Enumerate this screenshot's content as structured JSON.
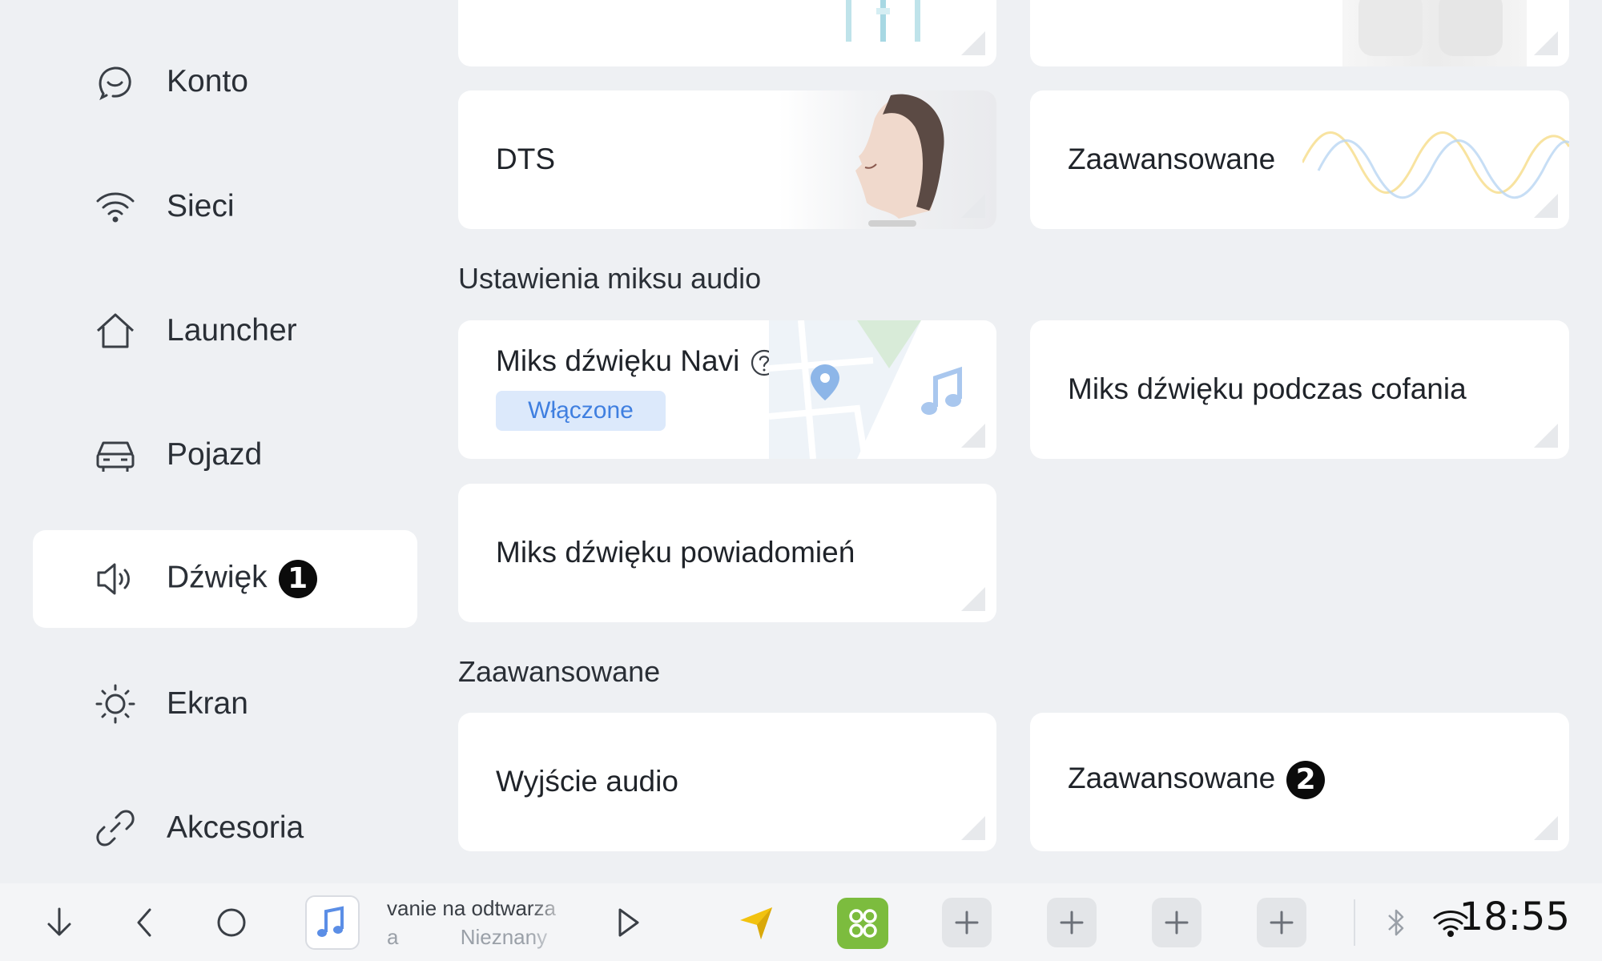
{
  "sidebar": {
    "items": [
      {
        "label": "Konto",
        "icon": "account-icon"
      },
      {
        "label": "Sieci",
        "icon": "wifi-icon"
      },
      {
        "label": "Launcher",
        "icon": "home-icon"
      },
      {
        "label": "Pojazd",
        "icon": "car-icon"
      },
      {
        "label": "Dźwięk",
        "icon": "speaker-icon",
        "active": true,
        "badge": "1"
      },
      {
        "label": "Ekran",
        "icon": "brightness-icon"
      },
      {
        "label": "Akcesoria",
        "icon": "link-icon"
      }
    ]
  },
  "content": {
    "top_cards": {
      "dts": "DTS",
      "advanced": "Zaawansowane"
    },
    "mix_section": {
      "title": "Ustawienia miksu audio",
      "navi_mix": {
        "label": "Miks dźwięku Navi",
        "status": "Włączone"
      },
      "reverse_mix": "Miks dźwięku podczas cofania",
      "notification_mix": "Miks dźwięku powiadomień"
    },
    "advanced_section": {
      "title": "Zaawansowane",
      "audio_output": "Wyjście audio",
      "advanced": "Zaawansowane",
      "badge": "2"
    }
  },
  "taskbar": {
    "media": {
      "title": "vanie na odtwarza",
      "subtitle_left": "a",
      "subtitle": "Nieznany"
    },
    "clock": "18:55"
  },
  "colors": {
    "background": "#eef0f3",
    "card": "#ffffff",
    "accent": "#3f7fe0",
    "apps_green": "#7cbc3e",
    "nav_arrow": "#f2c20f"
  }
}
